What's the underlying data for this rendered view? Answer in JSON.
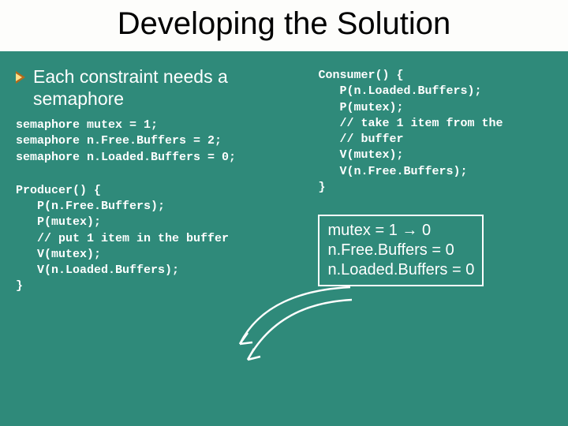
{
  "title": "Developing the Solution",
  "bullet": "Each constraint needs a semaphore",
  "decl": {
    "l1": "semaphore mutex = 1;",
    "l2": "semaphore n.Free.Buffers = 2;",
    "l3": "semaphore n.Loaded.Buffers = 0;"
  },
  "producer": {
    "l1": "Producer() {",
    "l2": "   P(n.Free.Buffers);",
    "l3": "   P(mutex);",
    "l4": "   // put 1 item in the buffer",
    "l5": "   V(mutex);",
    "l6": "   V(n.Loaded.Buffers);",
    "l7": "}"
  },
  "consumer": {
    "l1": "Consumer() {",
    "l2": "   P(n.Loaded.Buffers);",
    "l3": "   P(mutex);",
    "l4": "   // take 1 item from the",
    "l5": "   // buffer",
    "l6": "   V(mutex);",
    "l7": "   V(n.Free.Buffers);",
    "l8": "}"
  },
  "state": {
    "l1": "mutex = 1 → 0",
    "l2": "n.Free.Buffers = 0",
    "l3": "n.Loaded.Buffers = 0"
  }
}
